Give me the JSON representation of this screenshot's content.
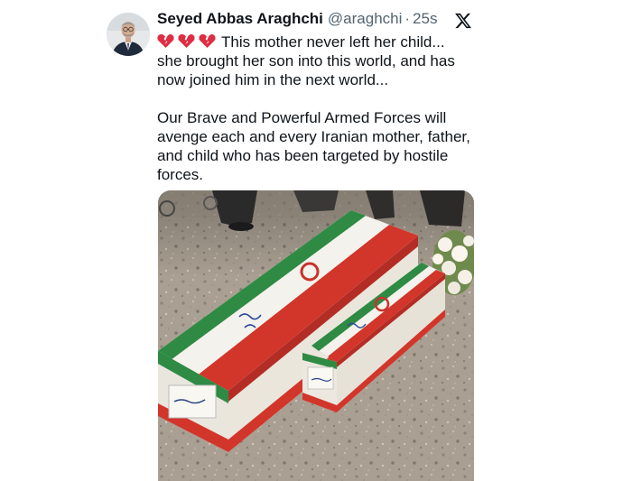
{
  "tweet": {
    "author": {
      "display_name": "Seyed Abbas Araghchi",
      "handle": "@araghchi",
      "avatar_icon": "avatar-photo"
    },
    "separator": "·",
    "timestamp": "25s",
    "platform_icon": "x-logo-icon",
    "text": {
      "emoji": [
        "broken-heart-icon",
        "broken-heart-icon",
        "broken-heart-icon"
      ],
      "paragraph_1": "This mother never left her child... she brought her son into this world, and has now joined him in the next world...",
      "paragraph_2": "Our Brave and Powerful Armed Forces will avenge each and every Iranian mother, father, and child who has been targeted by hostile forces."
    },
    "media": {
      "kind": "photo",
      "colors": {
        "green": "#2f8a44",
        "white": "#f4f2ec",
        "red": "#d2352a",
        "floor": "#a79d8f"
      }
    }
  }
}
